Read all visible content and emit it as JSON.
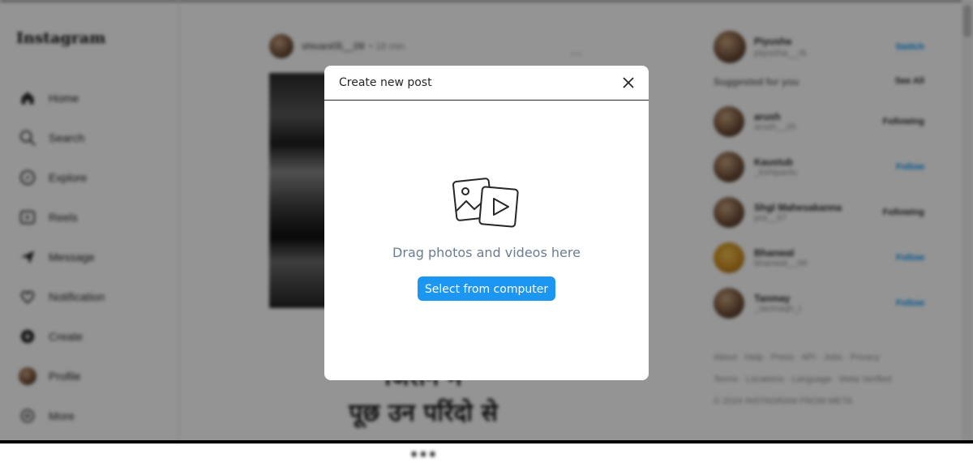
{
  "app": {
    "logo": "Instagram"
  },
  "sidebar": {
    "items": [
      {
        "label": "Home",
        "icon": "home-icon"
      },
      {
        "label": "Search",
        "icon": "search-icon"
      },
      {
        "label": "Explore",
        "icon": "explore-icon"
      },
      {
        "label": "Reels",
        "icon": "reels-icon"
      },
      {
        "label": "Message",
        "icon": "message-icon"
      },
      {
        "label": "Notification",
        "icon": "heart-icon"
      },
      {
        "label": "Create",
        "icon": "create-icon"
      },
      {
        "label": "Profile",
        "icon": "profile-icon"
      },
      {
        "label": "More",
        "icon": "menu-icon"
      }
    ]
  },
  "feed": {
    "post": {
      "username": "shivani05__09",
      "time": "• 18 min",
      "more": "...",
      "caption": "कि...\nजिसने में\nपूछ उन परिंदो से\n..."
    }
  },
  "right": {
    "me": {
      "name": "Piyusha",
      "handle": "piyusha__rk",
      "action": "Switch"
    },
    "suggestions_title": "Suggested for you",
    "see_all": "See All",
    "suggestions": [
      {
        "name": "arush",
        "sub": "arush__05",
        "action": "Following"
      },
      {
        "name": "Kaustub",
        "sub": "_kshtpanlu",
        "action": "Follow"
      },
      {
        "name": "Shgl Mahesakanna",
        "sub": "pra__97",
        "action": "Following"
      },
      {
        "name": "Bhanwal",
        "sub": "bhanwal__09",
        "action": "Follow"
      },
      {
        "name": "Tanmay",
        "sub": "_tanmaqh_t",
        "action": "Follow"
      }
    ],
    "footer": [
      "About · Help · Press · API · Jobs · Privacy",
      "Terms · Locations · Language · Meta Verified",
      "© 2024 INSTAGRAM FROM META"
    ]
  },
  "modal": {
    "title": "Create new post",
    "drag_text": "Drag photos and videos here",
    "select_button": "Select from computer"
  },
  "colors": {
    "primary_button": "#1c96f3",
    "drag_text": "#6b7c8e",
    "overlay": "rgba(0,0,0,0.42)"
  }
}
